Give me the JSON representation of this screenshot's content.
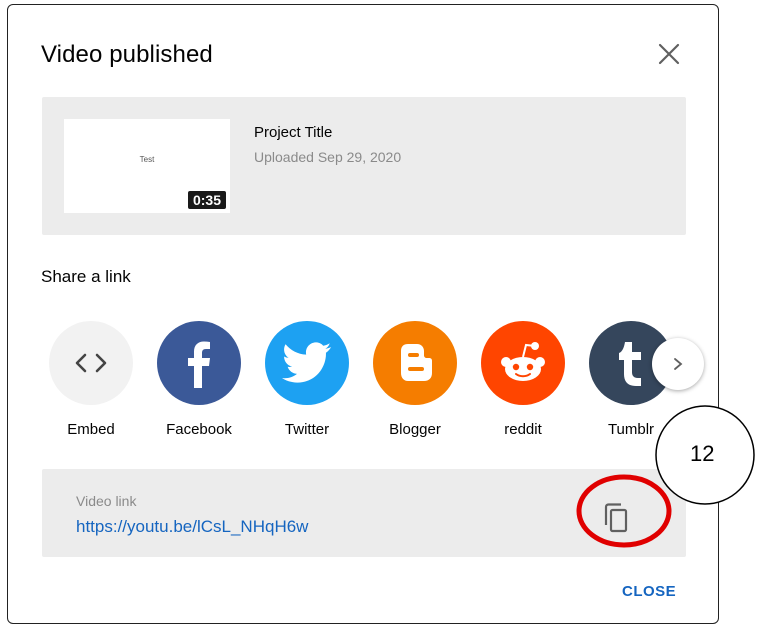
{
  "dialog": {
    "title": "Video published",
    "close_button_label": "CLOSE"
  },
  "video": {
    "thumbnail_text": "Test",
    "duration": "0:35",
    "title": "Project Title",
    "uploaded": "Uploaded Sep 29, 2020"
  },
  "share": {
    "label": "Share a link",
    "items": [
      {
        "name": "Embed",
        "icon": "embed-icon",
        "color": "#f2f2f2"
      },
      {
        "name": "Facebook",
        "icon": "facebook-icon",
        "color": "#3b5998"
      },
      {
        "name": "Twitter",
        "icon": "twitter-icon",
        "color": "#1da1f2"
      },
      {
        "name": "Blogger",
        "icon": "blogger-icon",
        "color": "#f57d00"
      },
      {
        "name": "reddit",
        "icon": "reddit-icon",
        "color": "#ff4500"
      },
      {
        "name": "Tumblr",
        "icon": "tumblr-icon",
        "color": "#35465c"
      }
    ]
  },
  "link": {
    "label": "Video link",
    "url": "https://youtu.be/lCsL_NHqH6w"
  },
  "annotation": {
    "callout_number": "12",
    "highlight_color": "#e00000"
  }
}
